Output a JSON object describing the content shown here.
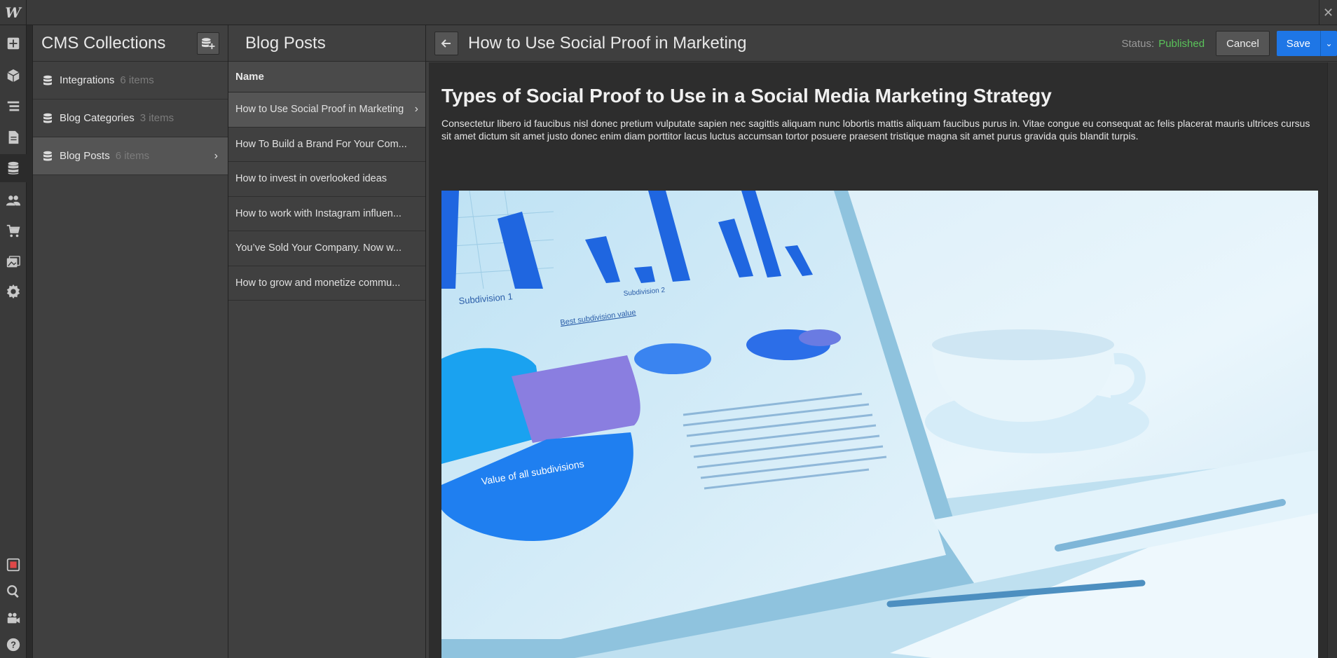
{
  "app": {
    "logo": "W",
    "close": "✕"
  },
  "rail": {
    "items": [
      "add-icon",
      "components-icon",
      "navigator-icon",
      "pages-icon",
      "cms-icon",
      "users-icon",
      "ecommerce-icon",
      "assets-icon",
      "settings-icon"
    ],
    "bottom": [
      "record-icon",
      "search-icon",
      "video-icon",
      "help-icon"
    ]
  },
  "collections": {
    "title": "CMS Collections",
    "items": [
      {
        "name": "Integrations",
        "count": "6 items"
      },
      {
        "name": "Blog Categories",
        "count": "3 items"
      },
      {
        "name": "Blog Posts",
        "count": "6 items"
      }
    ],
    "chevron": "›"
  },
  "posts": {
    "title": "Blog Posts",
    "column": "Name",
    "items": [
      "How to Use Social Proof in Marketing",
      "How To Build a Brand For Your Com...",
      "How to invest in overlooked ideas",
      "How to work with Instagram influen...",
      "You’ve Sold Your Company. Now w...",
      "How to grow and monetize commu..."
    ],
    "chevron": "›"
  },
  "editor": {
    "title": "How to Use Social Proof in Marketing",
    "status_label": "Status:",
    "status_value": "Published",
    "cancel": "Cancel",
    "save": "Save",
    "save_dropdown": "⌄",
    "heading": "Types of Social Proof to Use in a Social Media Marketing Strategy",
    "paragraph": "Consectetur libero id faucibus nisl donec pretium vulputate sapien nec sagittis aliquam nunc lobortis mattis aliquam faucibus purus in. Vitae congue eu consequat ac felis placerat mauris ultrices cursus sit amet dictum sit amet justo donec enim diam porttitor lacus luctus accumsan tortor posuere praesent tristique magna sit amet purus gravida quis blandit turpis."
  },
  "hero_image": {
    "labels": {
      "subdivision1": "Subdivision 1",
      "subdivision2": "Subdivision 2",
      "best_value": "Best subdivision value",
      "all_value": "Value of all subdivisions"
    }
  },
  "colors": {
    "accent": "#1e76e6",
    "published": "#5ac35a"
  }
}
